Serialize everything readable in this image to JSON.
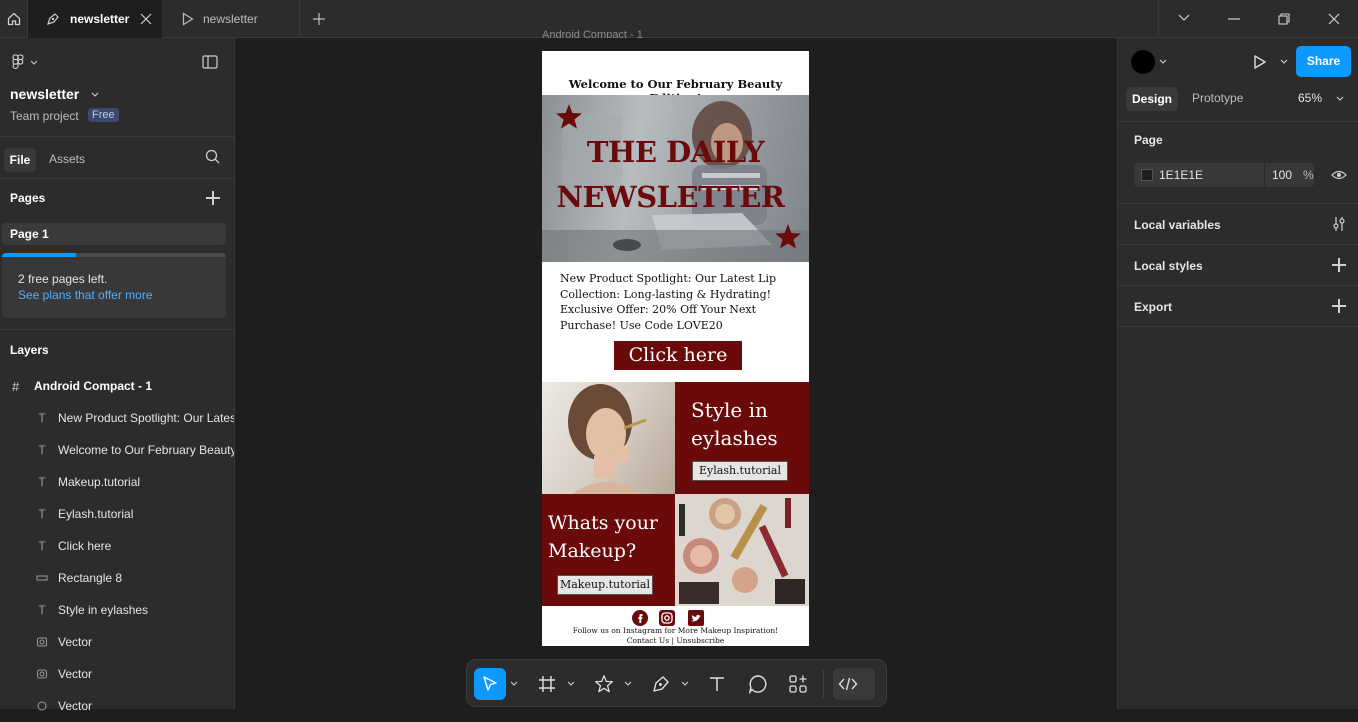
{
  "tabs": [
    {
      "label": "newsletter",
      "active": true
    },
    {
      "label": "newsletter",
      "active": false
    }
  ],
  "left_panel": {
    "file_name": "newsletter",
    "project": "Team project",
    "plan_badge": "Free",
    "tab_file": "File",
    "tab_assets": "Assets",
    "pages_title": "Pages",
    "current_page": "Page 1",
    "notice_text": "2 free pages left.",
    "notice_link": "See plans that offer more",
    "layers_title": "Layers",
    "frame_layer": "Android Compact - 1",
    "layers": [
      {
        "icon": "text-icon",
        "label": "New Product Spotlight: Our Latest Lip Collection"
      },
      {
        "icon": "text-icon",
        "label": "Welcome to Our February Beauty Edition!"
      },
      {
        "icon": "text-icon",
        "label": "Makeup.tutorial"
      },
      {
        "icon": "text-icon",
        "label": "Eylash.tutorial"
      },
      {
        "icon": "text-icon",
        "label": "Click here"
      },
      {
        "icon": "rectangle-icon",
        "label": "Rectangle 8"
      },
      {
        "icon": "text-icon",
        "label": "Style in eylashes"
      },
      {
        "icon": "vector-icon",
        "label": "Vector"
      },
      {
        "icon": "vector-icon",
        "label": "Vector"
      },
      {
        "icon": "vector-icon",
        "label": "Vector"
      }
    ]
  },
  "right_panel": {
    "tab_design": "Design",
    "tab_prototype": "Prototype",
    "zoom": "65%",
    "share_label": "Share",
    "page_section": "Page",
    "page_color_hex": "1E1E1E",
    "page_opacity": "100",
    "percent": "%",
    "local_variables": "Local variables",
    "local_styles": "Local styles",
    "export": "Export"
  },
  "canvas": {
    "frame_label": "Android Compact - 1",
    "newsletter": {
      "welcome": "Welcome to Our February Beauty Edition!",
      "hero_line1": "THE DAILY",
      "hero_line2": "NEWSLETTER",
      "body_text": "New Product Spotlight: Our Latest Lip Collection: Long-lasting & Hydrating! Exclusive Offer: 20% Off Your Next Purchase! Use Code LOVE20",
      "cta": "Click here",
      "eyelash_heading": "Style in eylashes",
      "eyelash_tag": "Eylash.tutorial",
      "makeup_heading": "Whats your Makeup?",
      "makeup_tag": "Makeup.tutorial",
      "footer_line1": "Follow us on Instagram for More Makeup Inspiration!",
      "footer_line2": "Contact Us | Unsubscribe"
    }
  },
  "colors": {
    "accent": "#0d99ff",
    "maroon": "#6b0a0a",
    "canvas_bg": "#1e1e1e",
    "panel_bg": "#2c2c2c"
  }
}
